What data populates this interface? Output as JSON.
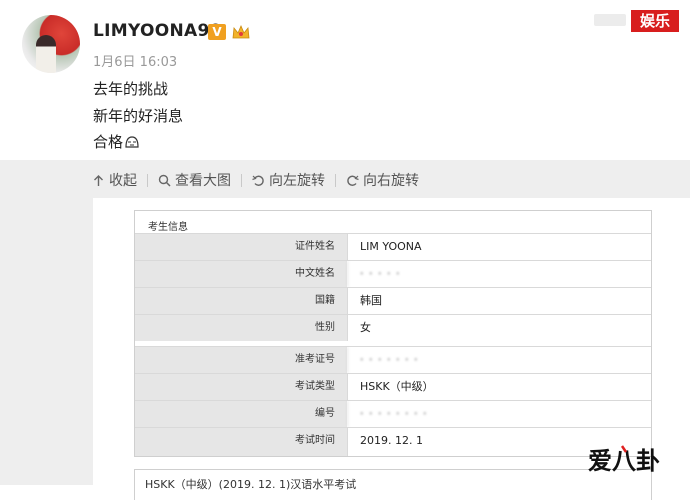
{
  "post": {
    "username": "LIMYOONA90",
    "verified_badge": "V",
    "timestamp": "1月6日 16:03",
    "lines": [
      "去年的挑战",
      "新年的好消息",
      "合格"
    ],
    "emoji_icon": "embarrassed-face-icon",
    "avatar_icon": "user-avatar"
  },
  "channel_badge": "娱乐",
  "toolbar": {
    "collapse": "收起",
    "view_large": "查看大图",
    "rotate_left": "向左旋转",
    "rotate_right": "向右旋转"
  },
  "certificate": {
    "section_title": "考生信息",
    "rows": [
      {
        "label": "证件姓名",
        "value": "LIM YOONA"
      },
      {
        "label": "中文姓名",
        "value": "·  ·  ·  ·  ·"
      },
      {
        "label": "国籍",
        "value": "韩国"
      },
      {
        "label": "性别",
        "value": "女"
      },
      {
        "label": "准考证号",
        "value": "·  ·  ·  ·  ·  ·  ·"
      },
      {
        "label": "考试类型",
        "value": "HSKK（中级）"
      },
      {
        "label": "编号",
        "value": "·  ·  ·  ·  ·  ·  ·  ·"
      },
      {
        "label": "考试时间",
        "value": "2019. 12. 1"
      }
    ],
    "lower_text": "HSKK（中级）(2019. 12. 1)汉语水平考试"
  },
  "watermark_text": "爱八卦",
  "colors": {
    "badge_red": "#d81e1e",
    "verified_orange": "#f0a020",
    "label_bg": "#e6e6e6",
    "viewer_bg": "#eeeeee"
  }
}
